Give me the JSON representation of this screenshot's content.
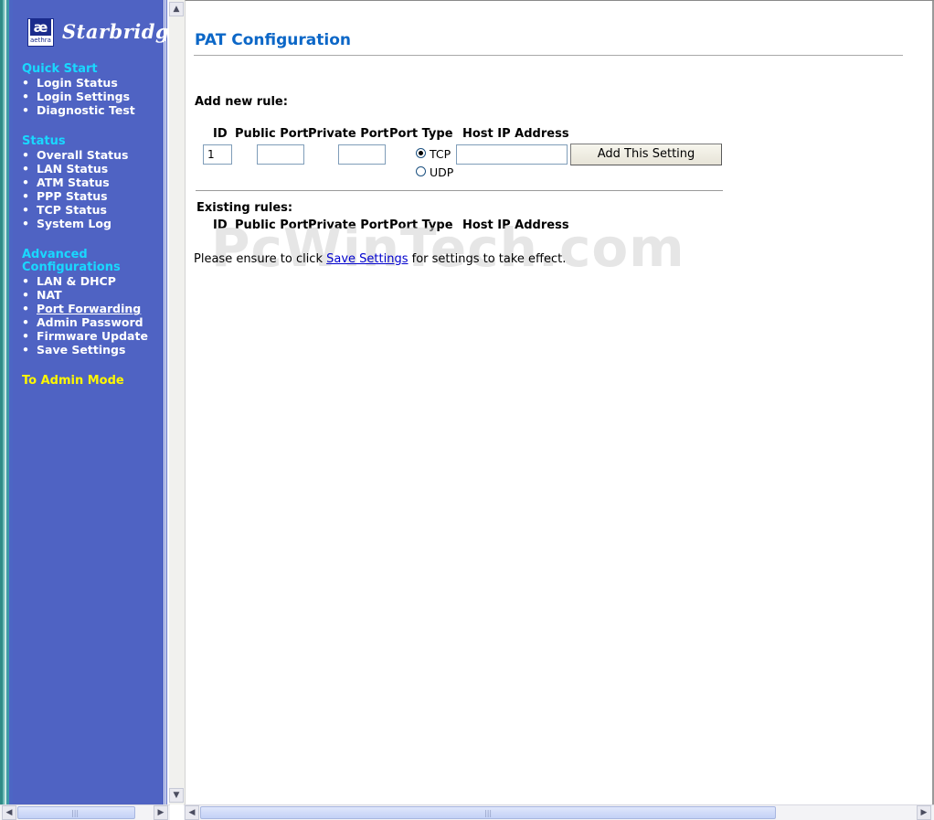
{
  "sidebar": {
    "logo_mark": "æ",
    "logo_word": "aethra",
    "logo_text": "Starbridge",
    "sections": [
      {
        "title": "Quick Start",
        "items": [
          "Login Status",
          "Login Settings",
          "Diagnostic Test"
        ]
      },
      {
        "title": "Status",
        "items": [
          "Overall Status",
          "LAN Status",
          "ATM Status",
          "PPP Status",
          "TCP Status",
          "System Log"
        ]
      },
      {
        "title_line1": "Advanced",
        "title_line2": "Configurations",
        "items": [
          "LAN & DHCP",
          "NAT",
          "Port Forwarding",
          "Admin Password",
          "Firmware Update",
          "Save Settings"
        ]
      }
    ],
    "active_item": "Port Forwarding",
    "admin_mode": "To Admin Mode"
  },
  "main": {
    "title": "PAT Configuration",
    "add_rule_label": "Add new rule:",
    "columns": [
      "ID",
      "Public Port",
      "Private Port",
      "Port Type",
      "Host IP Address"
    ],
    "new_rule": {
      "id_value": "1",
      "public_port": "",
      "private_port": "",
      "port_types": [
        "TCP",
        "UDP"
      ],
      "selected_port_type": "TCP",
      "host_ip": ""
    },
    "add_button": "Add This Setting",
    "existing_label": "Existing rules:",
    "note_before": "Please ensure to click ",
    "note_link": "Save Settings",
    "note_after": " for settings to take effect.",
    "watermark": "PcWinTech.com"
  },
  "scrollbar": {
    "up_arrow": "▲",
    "down_arrow": "▼",
    "left_arrow": "◀",
    "right_arrow": "▶",
    "grip": "|||"
  }
}
